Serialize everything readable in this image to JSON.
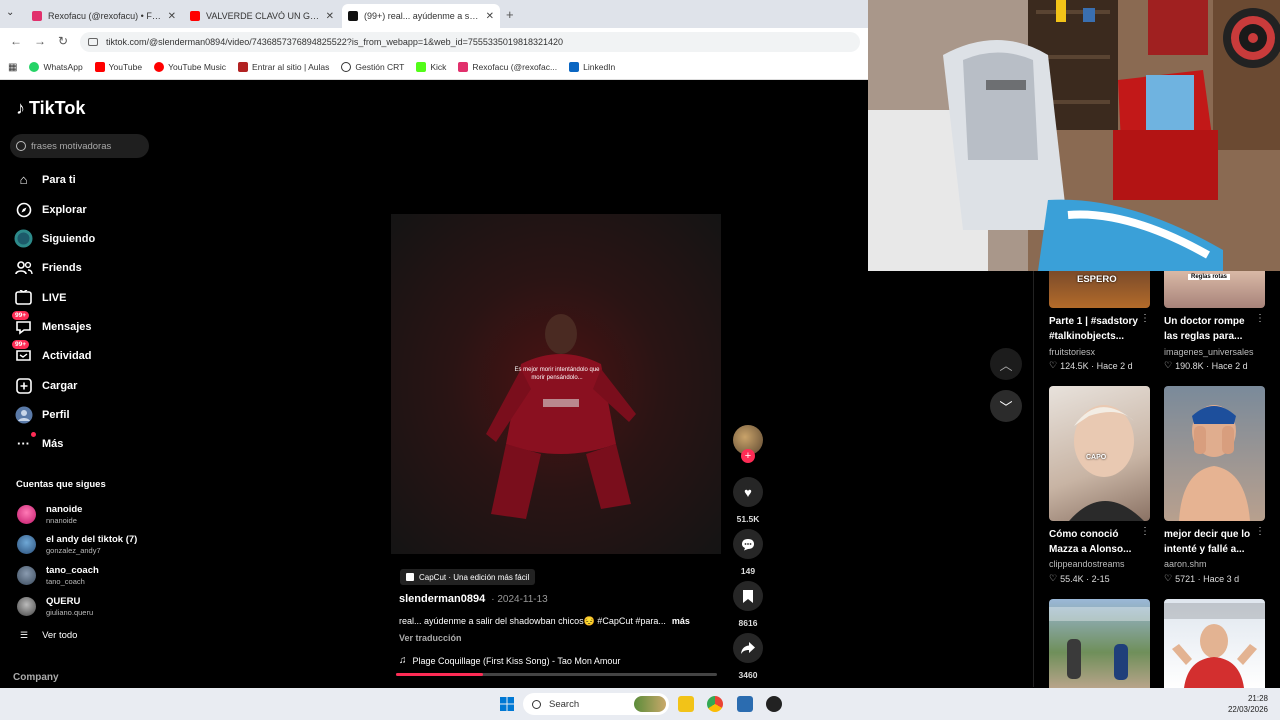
{
  "browser": {
    "tabs": [
      {
        "label": "Rexofacu (@rexofacu) • Fotos y",
        "favicon_color": "#e1306c"
      },
      {
        "label": "VALVERDE CLAVÓ UN GOLAZO",
        "favicon_color": "#ff0000"
      },
      {
        "label": "(99+) real... ayúdenme a salir de",
        "favicon_color": "#111111"
      }
    ],
    "active_tab": 2,
    "url": "tiktok.com/@slenderman0894/video/7436857376894825522?is_from_webapp=1&web_id=7555335019818321420",
    "bookmarks": [
      {
        "label": "WhatsApp",
        "icon_color": "#25d366"
      },
      {
        "label": "YouTube",
        "icon_color": "#ff0000"
      },
      {
        "label": "YouTube Music",
        "icon_color": "#ff0000"
      },
      {
        "label": "Entrar al sitio | Aulas",
        "icon_color": "#b22222"
      },
      {
        "label": "Gestión CRT",
        "icon_color": "#333333"
      },
      {
        "label": "Kick",
        "icon_color": "#53fc18"
      },
      {
        "label": "Rexofacu (@rexofac...",
        "icon_color": "#e1306c"
      },
      {
        "label": "LinkedIn",
        "icon_color": "#0a66c2"
      }
    ]
  },
  "tiktok": {
    "brand": "TikTok",
    "search_placeholder": "frases motivadoras",
    "nav": [
      {
        "label": "Para ti",
        "icon": "home-icon"
      },
      {
        "label": "Explorar",
        "icon": "compass-icon"
      },
      {
        "label": "Siguiendo",
        "icon": "following-icon"
      },
      {
        "label": "Friends",
        "icon": "friends-icon"
      },
      {
        "label": "LIVE",
        "icon": "live-icon"
      },
      {
        "label": "Mensajes",
        "icon": "messages-icon",
        "badge": "99+"
      },
      {
        "label": "Actividad",
        "icon": "activity-icon",
        "badge": "99+"
      },
      {
        "label": "Cargar",
        "icon": "upload-icon"
      },
      {
        "label": "Perfil",
        "icon": "profile-icon"
      },
      {
        "label": "Más",
        "icon": "more-icon"
      }
    ],
    "following_title": "Cuentas que sigues",
    "following": [
      {
        "name": "nanoide",
        "handle": "nnanoide"
      },
      {
        "name": "el andy del tiktok (7)",
        "handle": "gonzalez_andy7"
      },
      {
        "name": "tano_coach",
        "handle": "tano_coach"
      },
      {
        "name": "QUERU",
        "handle": "giuliano.queru"
      }
    ],
    "see_all": "Ver todo",
    "company": "Company"
  },
  "video": {
    "overlay_text": "Es mejor morir intentándolo que morir pensándolo...",
    "capcut_label": "CapCut · Una edición más fácil",
    "author": "slenderman0894",
    "date": "· 2024-11-13",
    "description": "real... ayúdenme a salir del shadowban chicos😔 #CapCut #para...",
    "more": "más",
    "translate": "Ver traducción",
    "music": "Plage Coquillage (First Kiss Song) - Tao Mon Amour",
    "progress": 0.27,
    "likes": "51.5K",
    "comments": "149",
    "saves": "8616",
    "shares": "3460"
  },
  "recommended": [
    {
      "title": "Parte 1 | #sadstory #talkinobjects...",
      "user": "fruitstoriesx",
      "likes": "124.5K",
      "date": "· Hace 2 d",
      "thumb_text": "ESPERO"
    },
    {
      "title": "Un doctor rompe las reglas para...",
      "user": "imagenes_universales",
      "likes": "190.8K",
      "date": "· Hace 2 d",
      "thumb_text": "Reglas rotas"
    },
    {
      "title": "Cómo conoció Mazza a Alonso...",
      "user": "clippeandostreams",
      "likes": "55.4K",
      "date": "· 2-15",
      "thumb_text": "CAPO"
    },
    {
      "title": "mejor decir que lo intenté y fallé a...",
      "user": "aaron.shm",
      "likes": "5721",
      "date": "· Hace 3 d",
      "thumb_text": ""
    }
  ],
  "taskbar": {
    "search": "Search",
    "time": "21:28",
    "date": "22/03/2026"
  }
}
